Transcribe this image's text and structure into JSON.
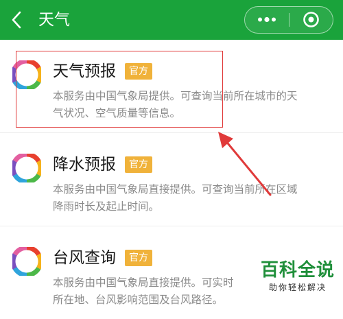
{
  "header": {
    "title": "天气",
    "back_icon": "chevron-left-icon",
    "more_icon": "more-dots-icon",
    "close_icon": "target-icon"
  },
  "colors": {
    "header_bg": "#1aa33b",
    "badge_bg": "#f0b23a",
    "highlight": "#e03a3a",
    "watermark": "#1f8f3a"
  },
  "services": [
    {
      "name": "天气预报",
      "badge": "官方",
      "desc": [
        "本服务由中国气象局提供。可查询当前所在城市的天",
        "气状况、空气质量等信息。"
      ],
      "icon": "weather-service-logo"
    },
    {
      "name": "降水预报",
      "badge": "官方",
      "desc": [
        "本服务由中国气象局直接提供。可查询当前所在区域",
        "降雨时长及起止时间。"
      ],
      "icon": "weather-service-logo"
    },
    {
      "name": "台风查询",
      "badge": "官方",
      "desc": [
        "本服务由中国气象局直接提供。可实时",
        "所在地、台风影响范围及台风路径。"
      ],
      "icon": "weather-service-logo"
    }
  ],
  "watermark": {
    "main": "百科全说",
    "sub": "助你轻松解决"
  }
}
